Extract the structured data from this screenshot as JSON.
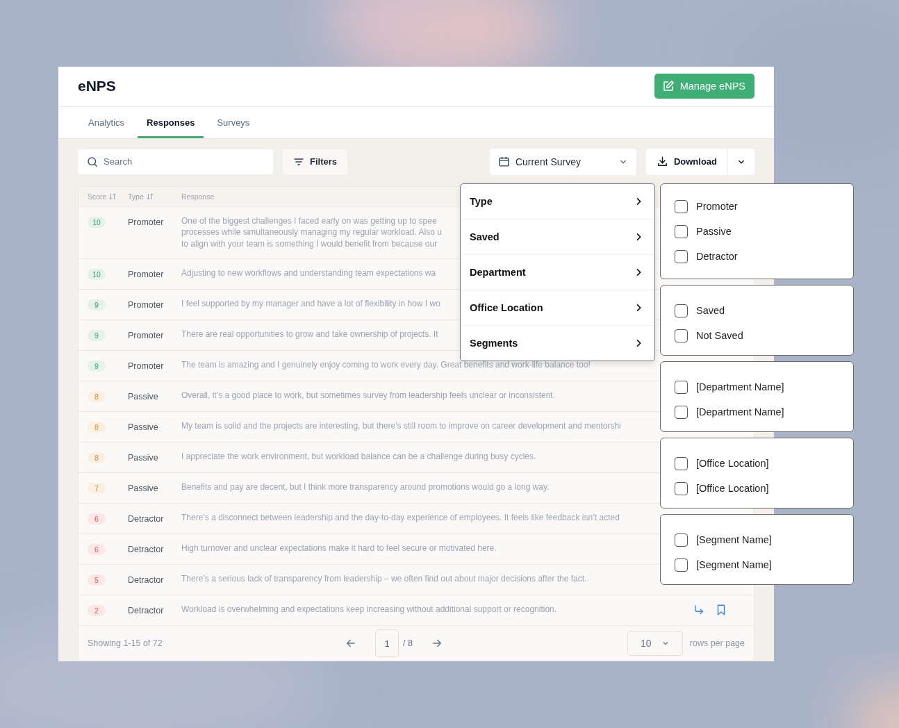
{
  "app": {
    "title": "eNPS",
    "manage_button": "Manage eNPS"
  },
  "tabs": [
    {
      "label": "Analytics",
      "selected": false
    },
    {
      "label": "Responses",
      "selected": true
    },
    {
      "label": "Surveys",
      "selected": false
    }
  ],
  "toolbar": {
    "search_placeholder": "Search",
    "filters": "Filters",
    "survey": "Current Survey",
    "download": "Download"
  },
  "table": {
    "columns": [
      "Score",
      "Type",
      "Response"
    ],
    "rows": [
      {
        "score": "10",
        "kind": "promoter",
        "type": "Promoter",
        "response": [
          "One of the biggest challenges I faced early on was getting up to spee",
          "processes while simultaneously managing my regular workload. Also u",
          "to align with your team is something I would benefit from because our"
        ]
      },
      {
        "score": "10",
        "kind": "promoter",
        "type": "Promoter",
        "response": [
          "Adjusting to new workflows and understanding team expectations wa"
        ]
      },
      {
        "score": "9",
        "kind": "promoter",
        "type": "Promoter",
        "response": [
          "I feel supported by my manager and have a lot of flexibility in how I wo"
        ]
      },
      {
        "score": "9",
        "kind": "promoter",
        "type": "Promoter",
        "response": [
          "There are real opportunities to grow and take ownership of projects. It"
        ]
      },
      {
        "score": "9",
        "kind": "promoter",
        "type": "Promoter",
        "response": [
          "The team is amazing and I genuinely enjoy coming to work every day. Great benefits and work-life balance too!"
        ]
      },
      {
        "score": "8",
        "kind": "passive",
        "type": "Passive",
        "response": [
          "Overall, it’s a good place to work, but sometimes survey from leadership feels unclear or inconsistent."
        ]
      },
      {
        "score": "8",
        "kind": "passive",
        "type": "Passive",
        "response": [
          "My team is solid and the projects are interesting, but there’s still room to improve on career development and mentorshi"
        ]
      },
      {
        "score": "8",
        "kind": "passive",
        "type": "Passive",
        "response": [
          "I appreciate the work environment, but workload balance can be a challenge during busy cycles."
        ]
      },
      {
        "score": "7",
        "kind": "passive",
        "type": "Passive",
        "response": [
          "Benefits and pay are decent, but I think more transparency around promotions would go a long way."
        ]
      },
      {
        "score": "6",
        "kind": "detractor",
        "type": "Detractor",
        "response": [
          "There’s a disconnect between leadership and the day-to-day experience of employees. It feels like feedback isn’t acted"
        ]
      },
      {
        "score": "6",
        "kind": "detractor",
        "type": "Detractor",
        "response": [
          "High turnover and unclear expectations make it hard to feel secure or motivated here."
        ]
      },
      {
        "score": "5",
        "kind": "detractor",
        "type": "Detractor",
        "response": [
          "There’s a serious lack of transparency from leadership – we often find out about major decisions after the fact."
        ]
      },
      {
        "score": "2",
        "kind": "detractor",
        "type": "Detractor",
        "response": [
          "Workload is overwhelming and expectations keep increasing without additional support or recognition."
        ]
      }
    ]
  },
  "pagination": {
    "showing": "Showing 1-15 of 72",
    "page": "1",
    "total": "/ 8",
    "rows_per_page": "10",
    "rows_label": "rows per page"
  },
  "filter_menu": [
    {
      "label": "Type"
    },
    {
      "label": "Saved"
    },
    {
      "label": "Department"
    },
    {
      "label": "Office Location"
    },
    {
      "label": "Segments"
    }
  ],
  "filter_options": [
    [
      {
        "label": "Promoter",
        "checked": false
      },
      {
        "label": "Passive",
        "checked": false
      },
      {
        "label": "Detractor",
        "checked": false
      }
    ],
    [
      {
        "label": "Saved",
        "checked": false
      },
      {
        "label": "Not Saved",
        "checked": false
      }
    ],
    [
      {
        "label": "[Department Name]",
        "checked": false
      },
      {
        "label": "[Department Name]",
        "checked": false
      }
    ],
    [
      {
        "label": "[Office Location]",
        "checked": false
      },
      {
        "label": "[Office Location]",
        "checked": false
      }
    ],
    [
      {
        "label": "[Segment Name]",
        "checked": false
      },
      {
        "label": "[Segment Name]",
        "checked": false
      }
    ]
  ]
}
